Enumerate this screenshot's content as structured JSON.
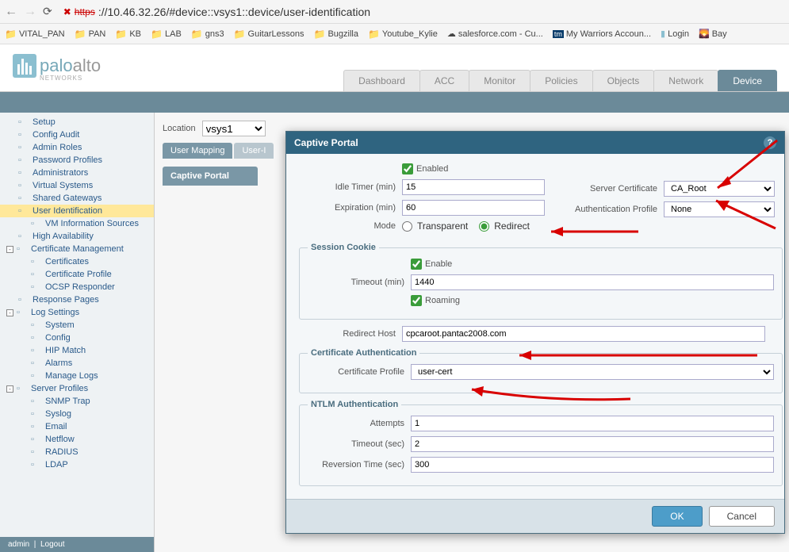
{
  "browser": {
    "url_scheme": "https",
    "url_rest": "://10.46.32.26/#device::vsys1::device/user-identification"
  },
  "bookmarks": [
    "VITAL_PAN",
    "PAN",
    "KB",
    "LAB",
    "gns3",
    "GuitarLessons",
    "Bugzilla",
    "Youtube_Kylie",
    "salesforce.com - Cu...",
    "My Warriors Accoun...",
    "Login",
    "Bay"
  ],
  "logo": {
    "main": "paloalto",
    "sub": "NETWORKS"
  },
  "top_tabs": [
    "Dashboard",
    "ACC",
    "Monitor",
    "Policies",
    "Objects",
    "Network",
    "Device"
  ],
  "active_top_tab": "Device",
  "location_label": "Location",
  "location_value": "vsys1",
  "sub_tabs": [
    "User Mapping",
    "User-I"
  ],
  "sub_panel": "Captive Portal",
  "sidebar": {
    "items": [
      {
        "label": "Setup",
        "indent": 0
      },
      {
        "label": "Config Audit",
        "indent": 0
      },
      {
        "label": "Admin Roles",
        "indent": 0
      },
      {
        "label": "Password Profiles",
        "indent": 0
      },
      {
        "label": "Administrators",
        "indent": 0
      },
      {
        "label": "Virtual Systems",
        "indent": 0
      },
      {
        "label": "Shared Gateways",
        "indent": 0
      },
      {
        "label": "User Identification",
        "indent": 0,
        "selected": true
      },
      {
        "label": "VM Information Sources",
        "indent": 1
      },
      {
        "label": "High Availability",
        "indent": 0
      },
      {
        "label": "Certificate Management",
        "indent": 0,
        "toggle": "-"
      },
      {
        "label": "Certificates",
        "indent": 1
      },
      {
        "label": "Certificate Profile",
        "indent": 1
      },
      {
        "label": "OCSP Responder",
        "indent": 1
      },
      {
        "label": "Response Pages",
        "indent": 0
      },
      {
        "label": "Log Settings",
        "indent": 0,
        "toggle": "-"
      },
      {
        "label": "System",
        "indent": 1
      },
      {
        "label": "Config",
        "indent": 1
      },
      {
        "label": "HIP Match",
        "indent": 1
      },
      {
        "label": "Alarms",
        "indent": 1
      },
      {
        "label": "Manage Logs",
        "indent": 1
      },
      {
        "label": "Server Profiles",
        "indent": 0,
        "toggle": "-"
      },
      {
        "label": "SNMP Trap",
        "indent": 1
      },
      {
        "label": "Syslog",
        "indent": 1
      },
      {
        "label": "Email",
        "indent": 1
      },
      {
        "label": "Netflow",
        "indent": 1
      },
      {
        "label": "RADIUS",
        "indent": 1
      },
      {
        "label": "LDAP",
        "indent": 1
      }
    ]
  },
  "footer": {
    "user": "admin",
    "logout": "Logout"
  },
  "modal": {
    "title": "Captive Portal",
    "enabled_label": "Enabled",
    "idle_timer_label": "Idle Timer (min)",
    "idle_timer_value": "15",
    "expiration_label": "Expiration (min)",
    "expiration_value": "60",
    "mode_label": "Mode",
    "mode_transparent": "Transparent",
    "mode_redirect": "Redirect",
    "server_cert_label": "Server Certificate",
    "server_cert_value": "CA_Root",
    "auth_profile_label": "Authentication Profile",
    "auth_profile_value": "None",
    "session_cookie": {
      "legend": "Session Cookie",
      "enable_label": "Enable",
      "timeout_label": "Timeout (min)",
      "timeout_value": "1440",
      "roaming_label": "Roaming"
    },
    "redirect_host_label": "Redirect Host",
    "redirect_host_value": "cpcaroot.pantac2008.com",
    "cert_auth": {
      "legend": "Certificate Authentication",
      "cert_profile_label": "Certificate Profile",
      "cert_profile_value": "user-cert"
    },
    "ntlm": {
      "legend": "NTLM Authentication",
      "attempts_label": "Attempts",
      "attempts_value": "1",
      "timeout_label": "Timeout (sec)",
      "timeout_value": "2",
      "reversion_label": "Reversion Time (sec)",
      "reversion_value": "300"
    },
    "ok": "OK",
    "cancel": "Cancel"
  }
}
